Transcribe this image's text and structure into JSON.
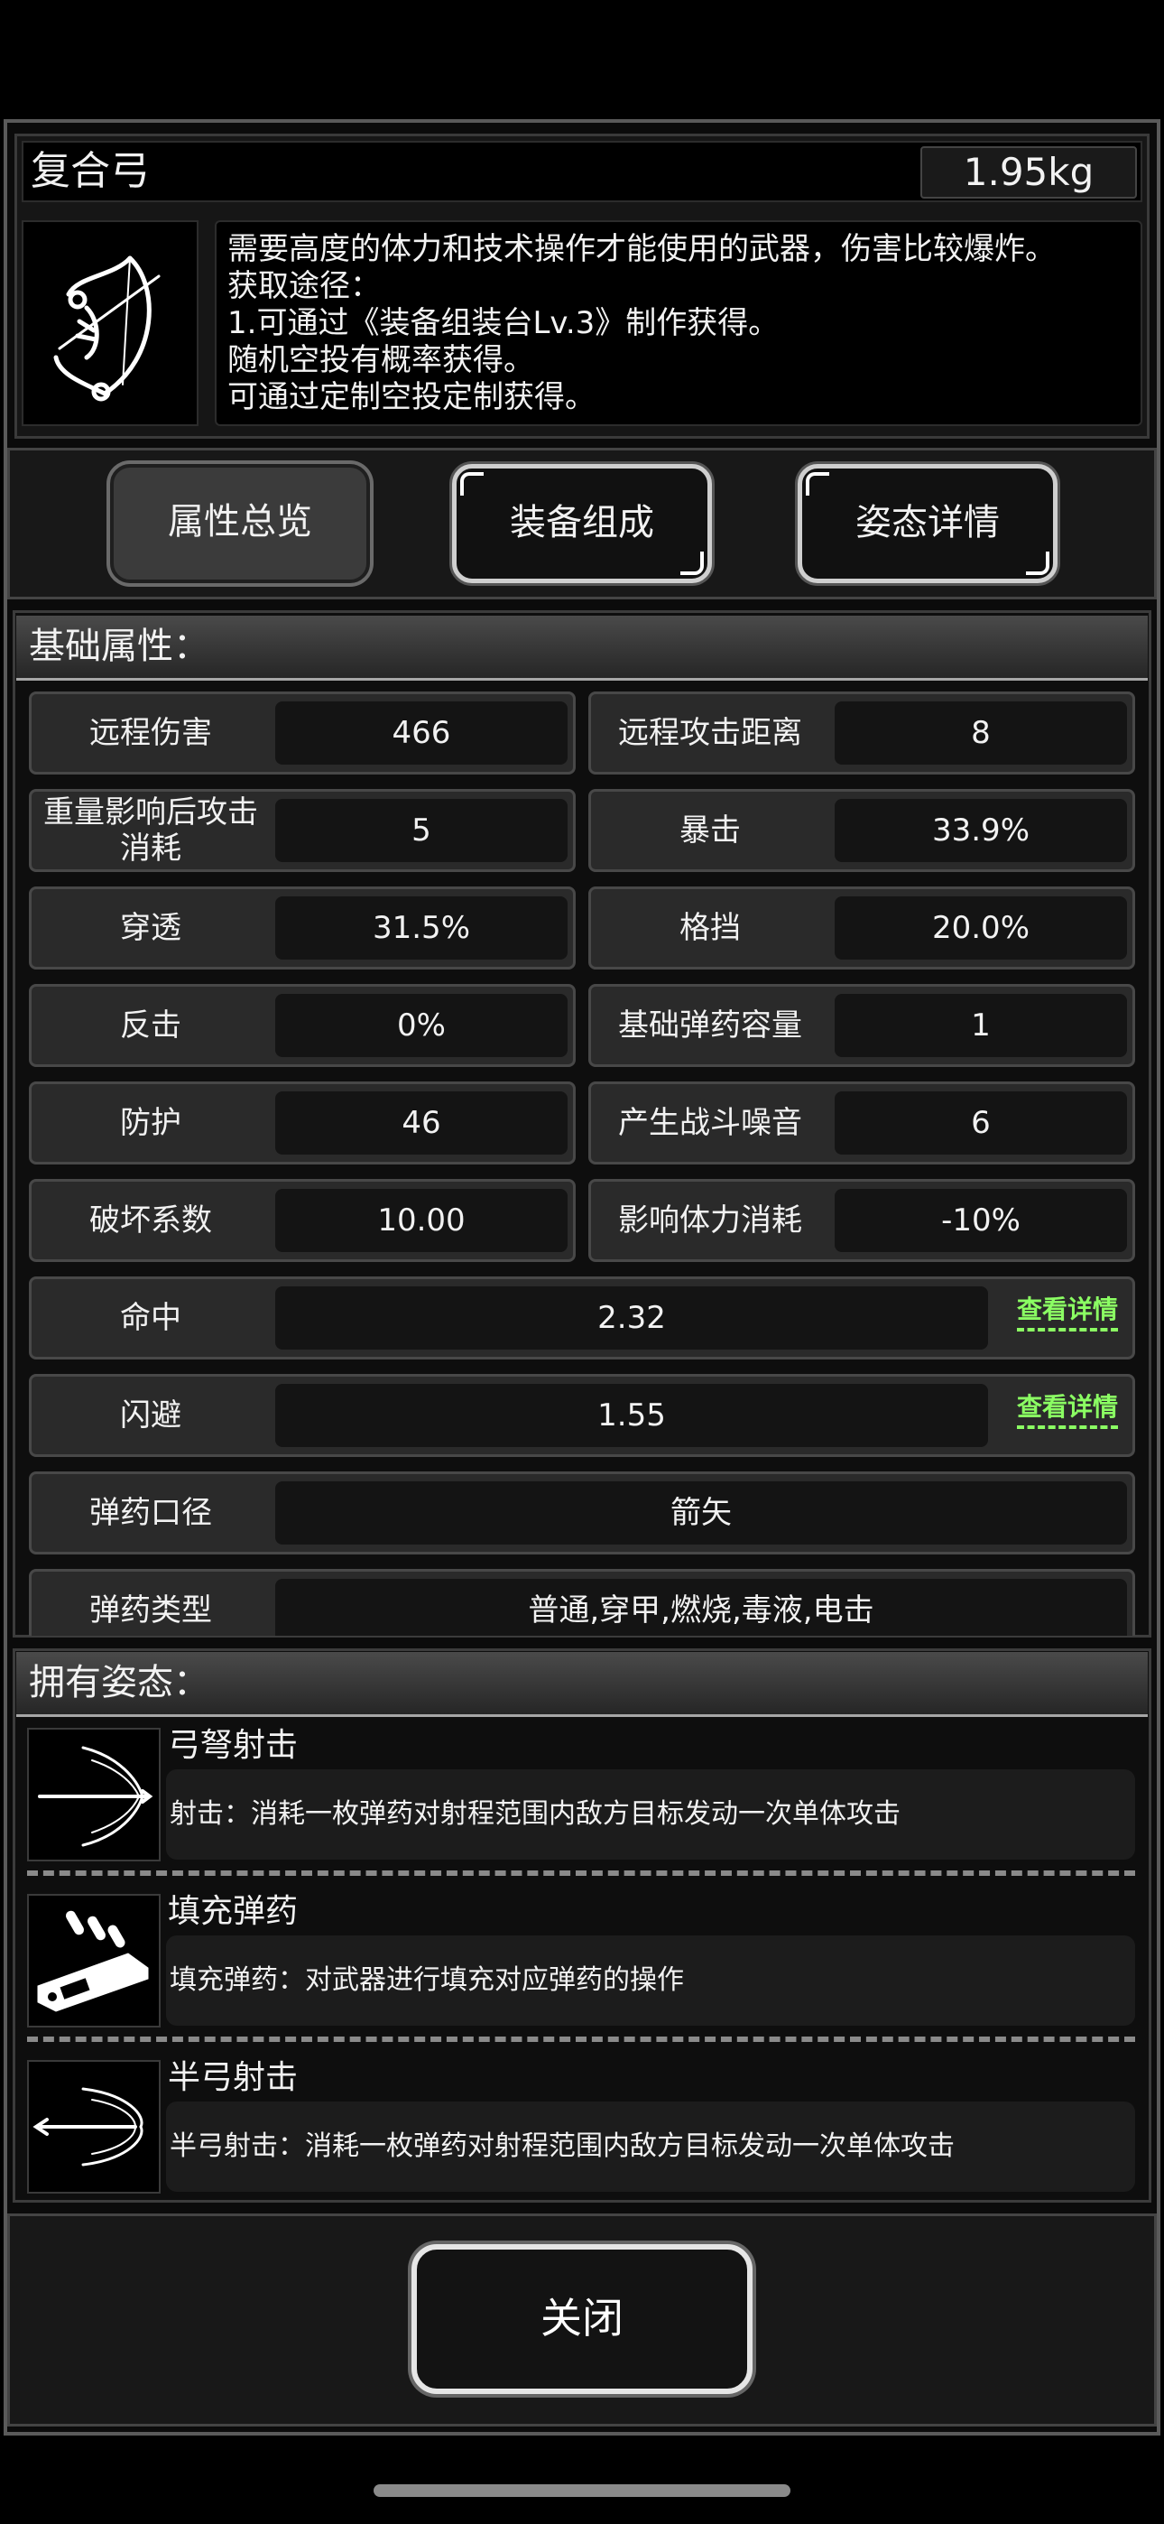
{
  "item": {
    "name": "复合弓",
    "weight": "1.95kg",
    "description": [
      "需要高度的体力和技术操作才能使用的武器，伤害比较爆炸。",
      "获取途径：",
      "1.可通过《装备组装台Lv.3》制作获得。",
      "随机空投有概率获得。",
      "可通过定制空投定制获得。"
    ],
    "icon": "compound-bow-icon"
  },
  "tabs": [
    {
      "label": "属性总览",
      "selected": true
    },
    {
      "label": "装备组成",
      "selected": false
    },
    {
      "label": "姿态详情",
      "selected": false
    }
  ],
  "attributes": {
    "header": "基础属性：",
    "pairs": [
      [
        {
          "label": "远程伤害",
          "value": "466"
        },
        {
          "label": "远程攻击距离",
          "value": "8"
        }
      ],
      [
        {
          "label": "重量影响后攻击消耗",
          "value": "5"
        },
        {
          "label": "暴击",
          "value": "33.9%"
        }
      ],
      [
        {
          "label": "穿透",
          "value": "31.5%"
        },
        {
          "label": "格挡",
          "value": "20.0%"
        }
      ],
      [
        {
          "label": "反击",
          "value": "0%"
        },
        {
          "label": "基础弹药容量",
          "value": "1"
        }
      ],
      [
        {
          "label": "防护",
          "value": "46"
        },
        {
          "label": "产生战斗噪音",
          "value": "6"
        }
      ],
      [
        {
          "label": "破坏系数",
          "value": "10.00"
        },
        {
          "label": "影响体力消耗",
          "value": "-10%"
        }
      ]
    ],
    "wide": [
      {
        "label": "命中",
        "value": "2.32",
        "link": "查看详情"
      },
      {
        "label": "闪避",
        "value": "1.55",
        "link": "查看详情"
      },
      {
        "label": "弹药口径",
        "value": "箭矢"
      },
      {
        "label": "弹药类型",
        "value": "普通,穿甲,燃烧,毒液,电击"
      }
    ]
  },
  "stances": {
    "header": "拥有姿态：",
    "items": [
      {
        "name": "弓弩射击",
        "desc": "射击：消耗一枚弹药对射程范围内敌方目标发动一次单体攻击",
        "icon": "bow-shot-icon"
      },
      {
        "name": "填充弹药",
        "desc": "填充弹药：对武器进行填充对应弹药的操作",
        "icon": "reload-ammo-icon"
      },
      {
        "name": "半弓射击",
        "desc": "半弓射击：消耗一枚弹药对射程范围内敌方目标发动一次单体攻击",
        "icon": "half-bow-shot-icon"
      }
    ]
  },
  "close_label": "关闭"
}
